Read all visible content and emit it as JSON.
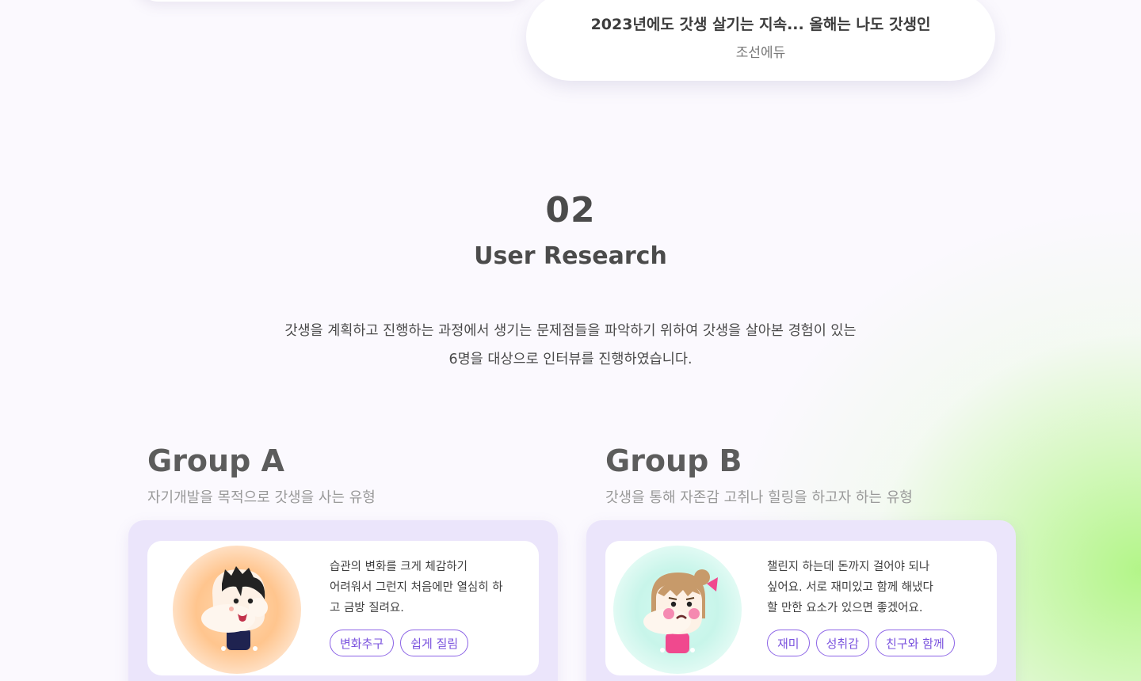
{
  "news": {
    "title": "2023년에도 갓생 살기는 지속... 올해는 나도 갓생인",
    "source": "조선에듀"
  },
  "section": {
    "number": "02",
    "title": "User Research",
    "desc_line1": "갓생을 계획하고 진행하는 과정에서 생기는 문제점들을 파악하기 위하여  갓생을 살아본 경험이 있는",
    "desc_line2": "6명을  대상으로 인터뷰를 진행하였습니다."
  },
  "groups": [
    {
      "title": "Group A",
      "subtitle": "자기개발을 목적으로 갓생을 사는 유형",
      "avatar_icon": "boy-avatar-icon",
      "avatar_color": "#ffc58e",
      "quote_line1": "습관의 변화를 크게 체감하기",
      "quote_line2": "어려워서 그런지 처음에만 열심히 하",
      "quote_line3": "고 금방 질려요.",
      "tags": [
        "변화추구",
        "쉽게 질림"
      ]
    },
    {
      "title": "Group B",
      "subtitle": "갓생을 통해 자존감 고취나 힐링을 하고자 하는 유형",
      "avatar_icon": "girl-avatar-icon",
      "avatar_color": "#c8f5ea",
      "quote_line1": "챌린지 하는데 돈까지 걸어야 되나",
      "quote_line2": "싶어요. 서로 재미있고 함께 해냈다",
      "quote_line3": "할 만한 요소가 있으면 좋겠어요.",
      "tags": [
        "재미",
        "성취감",
        "친구와 함께"
      ]
    }
  ],
  "colors": {
    "accent": "#7a52de",
    "card_bg": "#ebe5fb",
    "glow": "#aff582"
  }
}
